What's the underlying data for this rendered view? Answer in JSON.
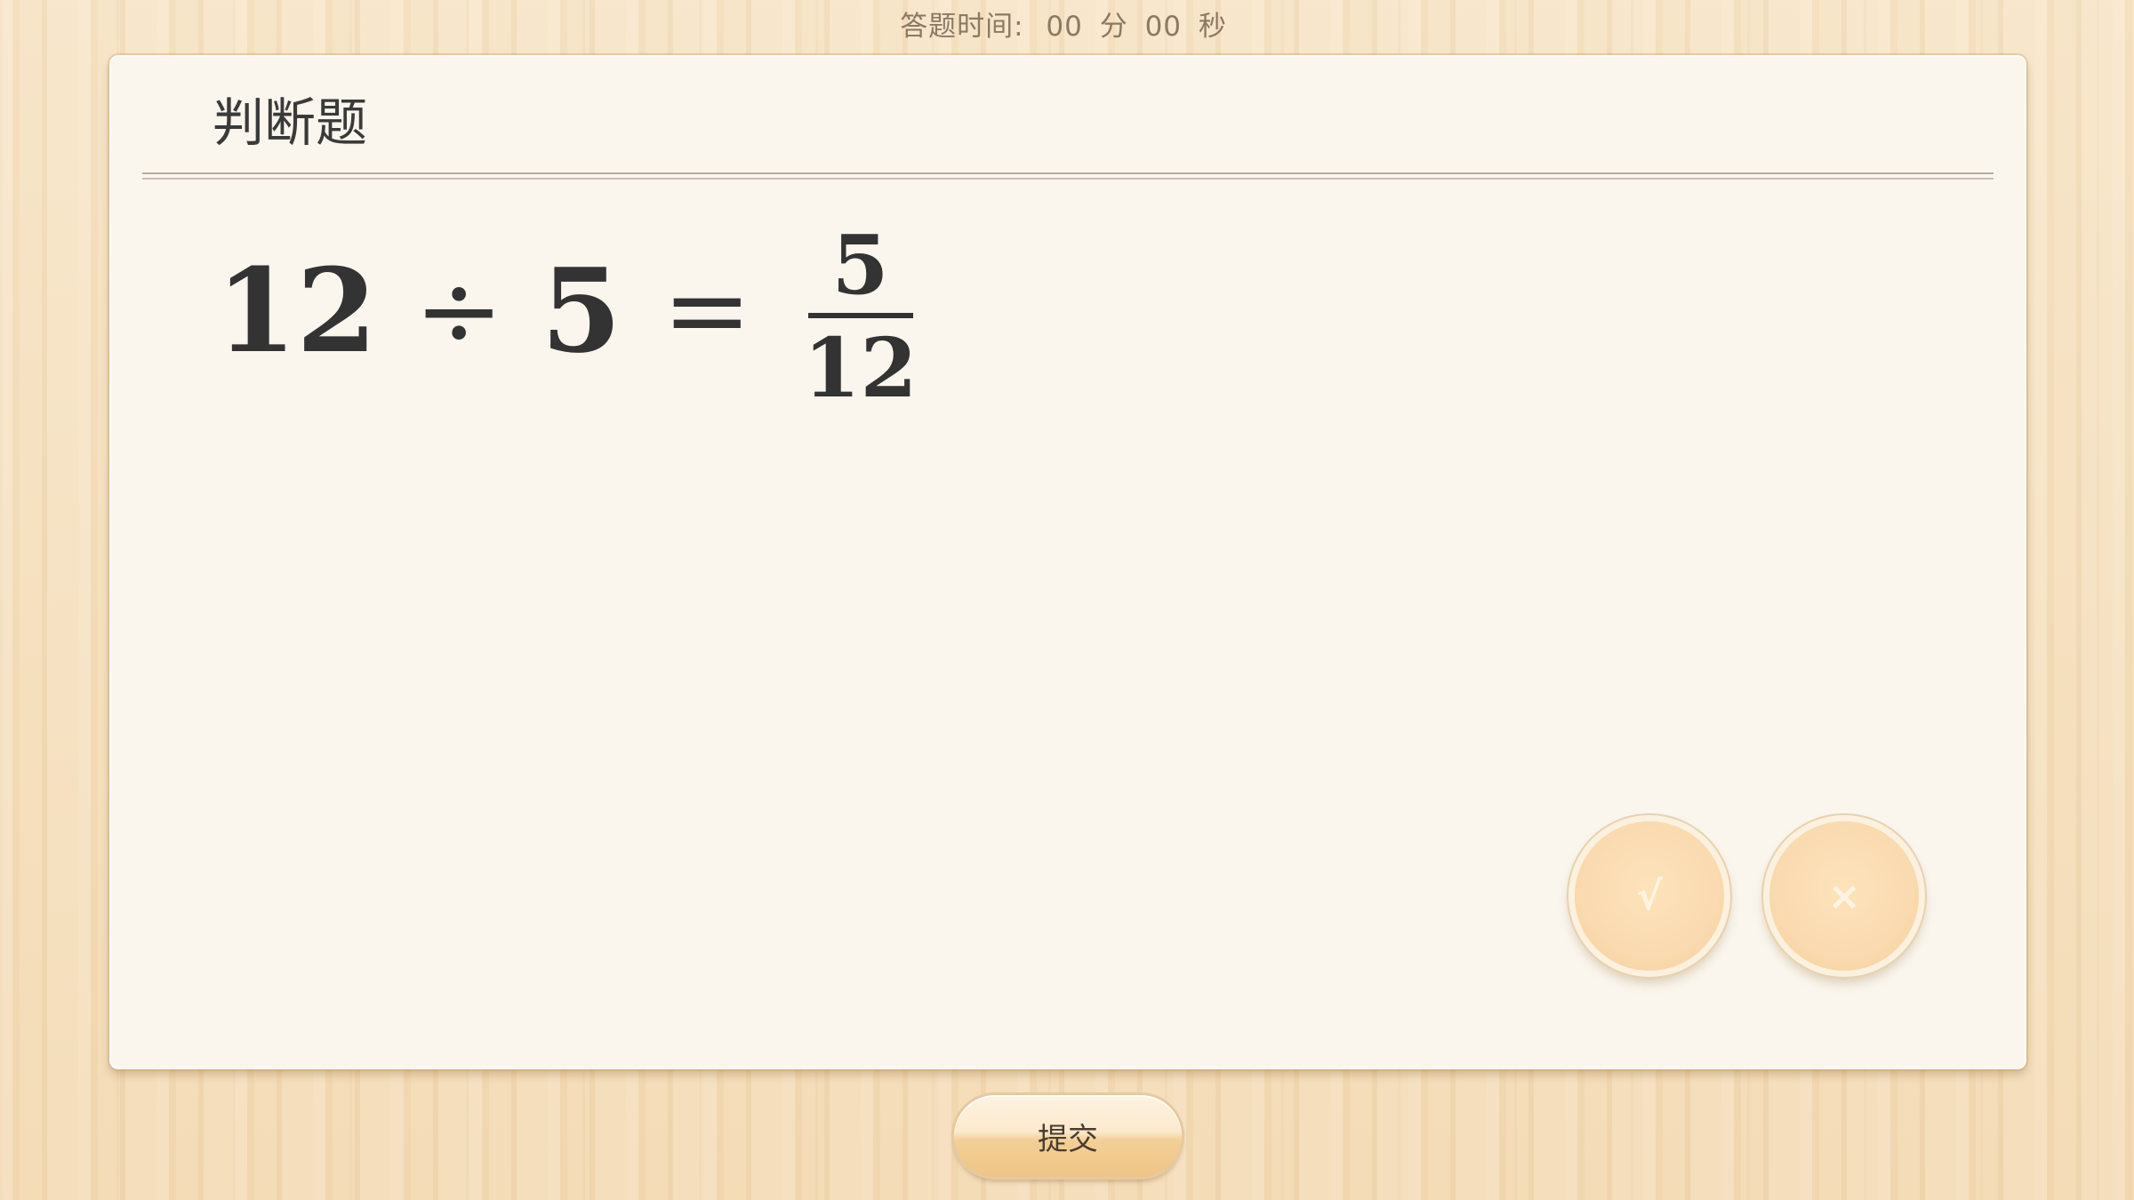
{
  "header": {
    "timer_label": "答题时间:",
    "minutes": "00",
    "minutes_unit": "分",
    "seconds": "00",
    "seconds_unit": "秒"
  },
  "question": {
    "type_label": "判断题",
    "equation": {
      "left_operand": "12",
      "operator": "÷",
      "right_operand": "5",
      "equals": "=",
      "numerator": "5",
      "denominator": "12"
    }
  },
  "answers": {
    "true_label": "√",
    "false_label": "×"
  },
  "footer": {
    "submit_label": "提交"
  }
}
